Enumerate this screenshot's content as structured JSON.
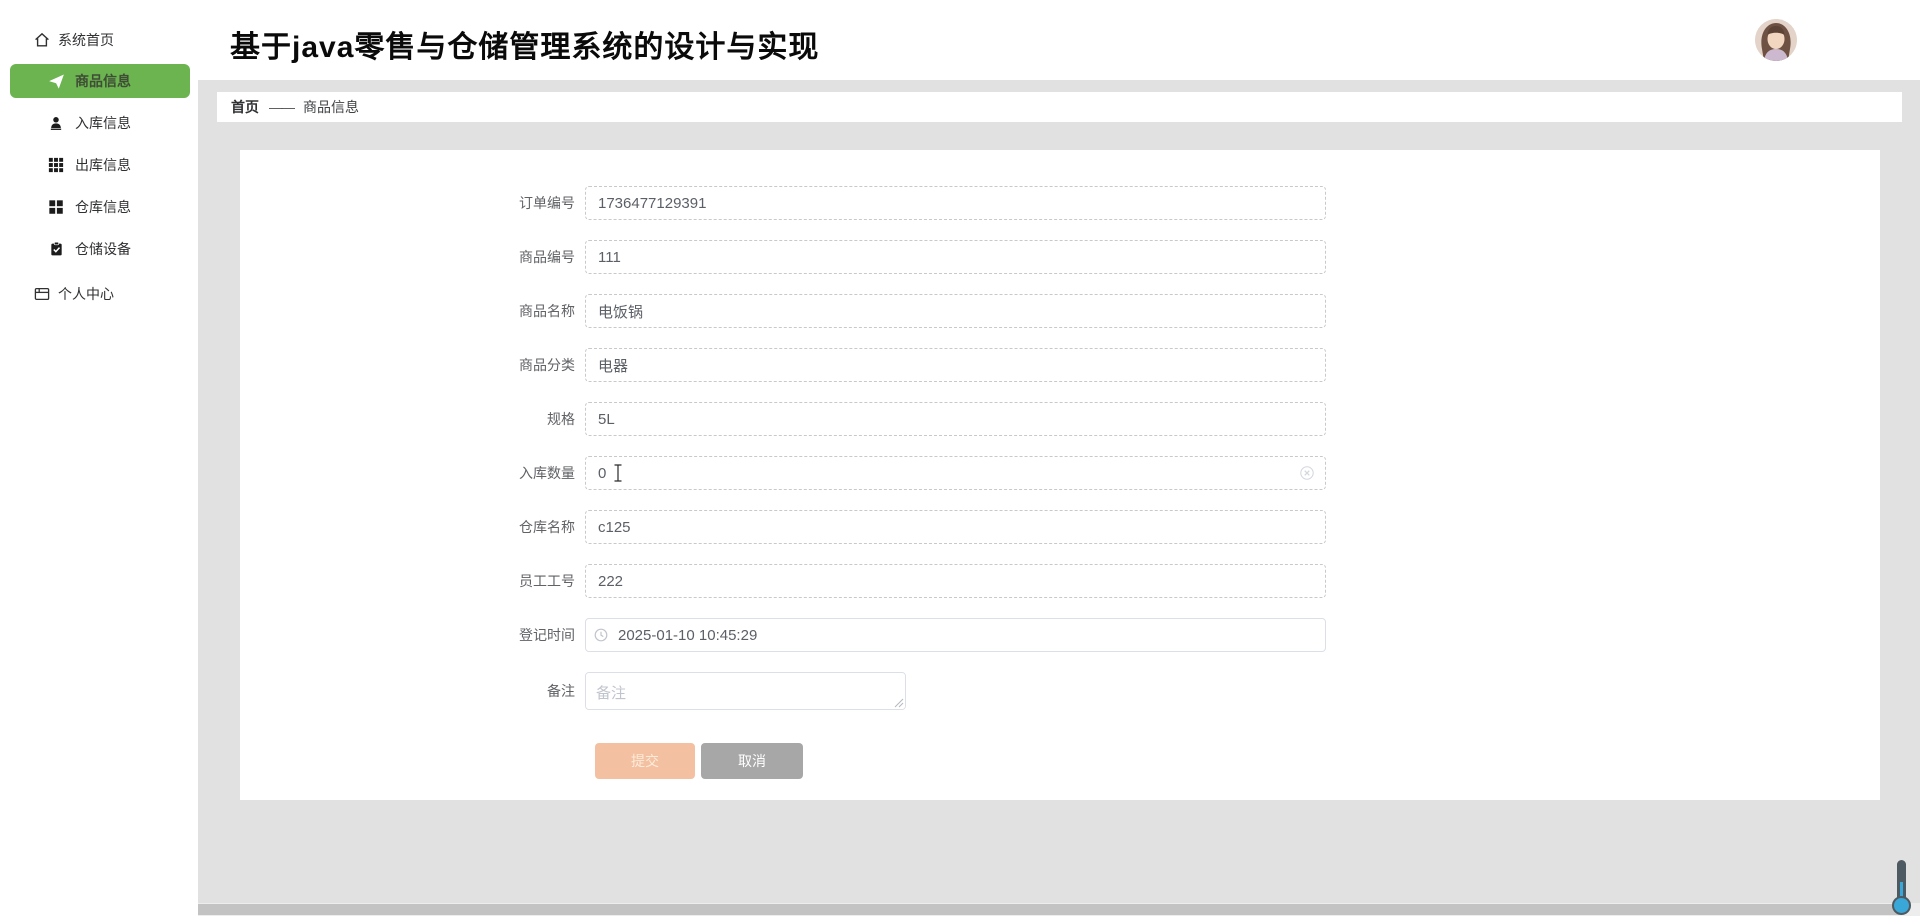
{
  "header": {
    "title": "基于java零售与仓储管理系统的设计与实现"
  },
  "sidebar": {
    "items": [
      {
        "label": "系统首页",
        "icon": "home-icon",
        "active": false
      },
      {
        "label": "商品信息",
        "icon": "send-icon",
        "active": true
      },
      {
        "label": "入库信息",
        "icon": "user-icon",
        "active": false
      },
      {
        "label": "出库信息",
        "icon": "grid9-icon",
        "active": false
      },
      {
        "label": "仓库信息",
        "icon": "grid4-icon",
        "active": false
      },
      {
        "label": "仓储设备",
        "icon": "clipboard-check-icon",
        "active": false
      },
      {
        "label": "个人中心",
        "icon": "profile-card-icon",
        "active": false
      }
    ]
  },
  "breadcrumb": {
    "home": "首页",
    "separator": "——",
    "current": "商品信息"
  },
  "form": {
    "fields": [
      {
        "label": "订单编号",
        "value": "1736477129391"
      },
      {
        "label": "商品编号",
        "value": "111"
      },
      {
        "label": "商品名称",
        "value": "电饭锅"
      },
      {
        "label": "商品分类",
        "value": "电器"
      },
      {
        "label": "规格",
        "value": "5L"
      },
      {
        "label": "入库数量",
        "value": "0"
      },
      {
        "label": "仓库名称",
        "value": "c125"
      },
      {
        "label": "员工工号",
        "value": "222"
      },
      {
        "label": "登记时间",
        "value": "2025-01-10 10:45:29"
      },
      {
        "label": "备注",
        "value": "",
        "placeholder": "备注"
      }
    ],
    "buttons": {
      "submit": "提交",
      "cancel": "取消"
    }
  },
  "colors": {
    "active_green": "#6bb450",
    "submit_peach": "#f3c1a1",
    "cancel_gray": "#a7a7a7",
    "scroll_blue": "#3aa7d9",
    "content_bg": "#e1e1e1"
  }
}
